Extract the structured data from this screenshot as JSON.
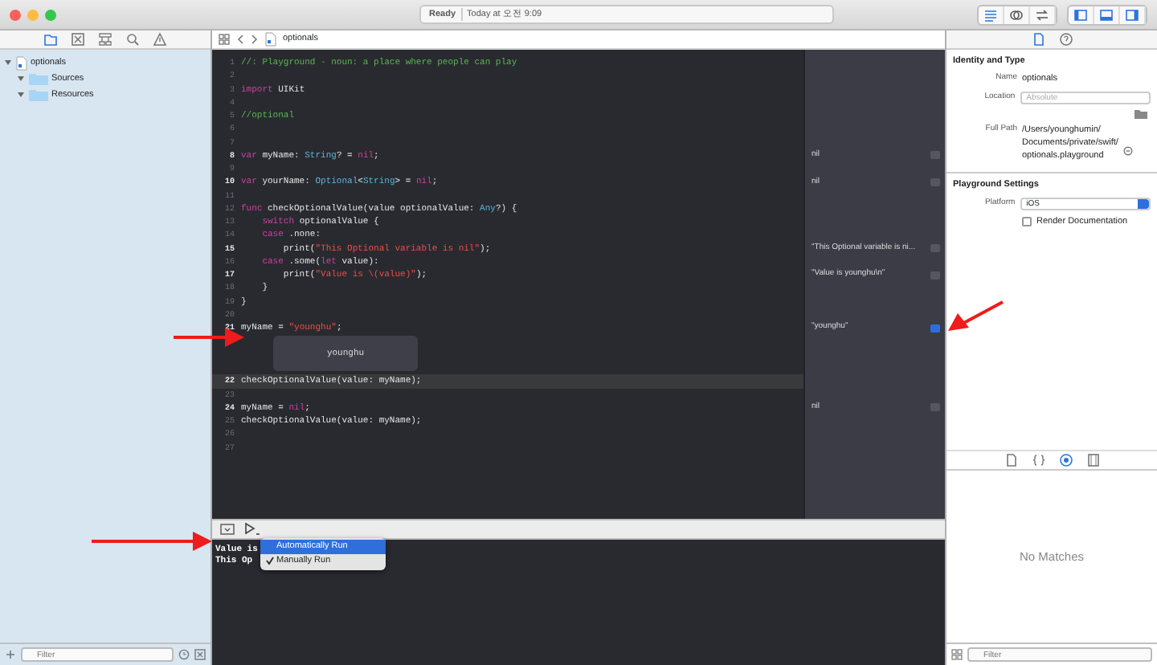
{
  "window": {
    "status": "Ready",
    "time": "Today at 오전 9:09"
  },
  "toolbar_buttons": [
    {
      "kind": "standard",
      "selected": true
    },
    {
      "kind": "assistant",
      "selected": false
    },
    {
      "kind": "version",
      "selected": false
    },
    {
      "kind": "navigator",
      "selected": true
    },
    {
      "kind": "debug",
      "selected": true
    },
    {
      "kind": "utilities",
      "selected": true
    }
  ],
  "navigator": {
    "tabs": [
      {
        "kind": "folder",
        "selected": true
      },
      {
        "kind": "xbox",
        "selected": false
      },
      {
        "kind": "hierarchy",
        "selected": false
      },
      {
        "kind": "search",
        "selected": false
      },
      {
        "kind": "warning",
        "selected": false
      }
    ],
    "tree": [
      {
        "label": "optionals",
        "kind": "file",
        "expanded": true,
        "children": [
          {
            "label": "Sources",
            "kind": "folder",
            "expanded": true
          },
          {
            "label": "Resources",
            "kind": "folder",
            "expanded": true
          }
        ]
      }
    ],
    "filter": {
      "placeholder": "Filter"
    }
  },
  "jump_bar": {
    "file": "optionals"
  },
  "code": [
    {
      "number": "1",
      "marked": false,
      "current": false,
      "tokens": [
        {
          "kind": "comment",
          "text": "//: Playground - noun: a place where people can play"
        }
      ]
    },
    {
      "number": "2",
      "marked": false,
      "current": false
    },
    {
      "number": "3",
      "marked": false,
      "current": false,
      "tokens": [
        {
          "kind": "keyword",
          "text": "import"
        },
        {
          "kind": "plain",
          "text": " UIKit"
        }
      ]
    },
    {
      "number": "4",
      "marked": false,
      "current": false
    },
    {
      "number": "5",
      "marked": false,
      "current": false,
      "tokens": [
        {
          "kind": "comment",
          "text": "//optional"
        }
      ]
    },
    {
      "number": "6",
      "marked": false,
      "current": false
    },
    {
      "number": "7",
      "marked": false,
      "current": false
    },
    {
      "number": "8",
      "marked": true,
      "current": false,
      "tokens": [
        {
          "kind": "keyword",
          "text": "var"
        },
        {
          "kind": "plain",
          "text": " myName: "
        },
        {
          "kind": "type",
          "text": "String"
        },
        {
          "kind": "plain",
          "text": "? = "
        },
        {
          "kind": "keyword",
          "text": "nil"
        },
        {
          "kind": "plain",
          "text": ";"
        }
      ],
      "result": {
        "text": "nil",
        "quicklook_selected": false
      }
    },
    {
      "number": "9",
      "marked": false,
      "current": false
    },
    {
      "number": "10",
      "marked": true,
      "current": false,
      "tokens": [
        {
          "kind": "keyword",
          "text": "var"
        },
        {
          "kind": "plain",
          "text": " yourName: "
        },
        {
          "kind": "type",
          "text": "Optional"
        },
        {
          "kind": "plain",
          "text": "<"
        },
        {
          "kind": "type",
          "text": "String"
        },
        {
          "kind": "plain",
          "text": "> = "
        },
        {
          "kind": "keyword",
          "text": "nil"
        },
        {
          "kind": "plain",
          "text": ";"
        }
      ],
      "result": {
        "text": "nil",
        "quicklook_selected": false
      }
    },
    {
      "number": "11",
      "marked": false,
      "current": false
    },
    {
      "number": "12",
      "marked": false,
      "current": false,
      "tokens": [
        {
          "kind": "keyword",
          "text": "func"
        },
        {
          "kind": "plain",
          "text": " checkOptionalValue(value optionalValue: "
        },
        {
          "kind": "type",
          "text": "Any"
        },
        {
          "kind": "plain",
          "text": "?) {"
        }
      ]
    },
    {
      "number": "13",
      "marked": false,
      "current": false,
      "tokens": [
        {
          "kind": "keyword",
          "text": "    switch"
        },
        {
          "kind": "plain",
          "text": " optionalValue {"
        }
      ]
    },
    {
      "number": "14",
      "marked": false,
      "current": false,
      "tokens": [
        {
          "kind": "keyword",
          "text": "    case"
        },
        {
          "kind": "plain",
          "text": " .none:"
        }
      ]
    },
    {
      "number": "15",
      "marked": true,
      "current": false,
      "tokens": [
        {
          "kind": "plain",
          "text": "        print("
        },
        {
          "kind": "string",
          "text": "\"This Optional variable is nil\""
        },
        {
          "kind": "plain",
          "text": ");"
        }
      ],
      "result": {
        "text": "\"This Optional variable is ni...",
        "quicklook_selected": false
      }
    },
    {
      "number": "16",
      "marked": false,
      "current": false,
      "tokens": [
        {
          "kind": "keyword",
          "text": "    case"
        },
        {
          "kind": "plain",
          "text": " .some("
        },
        {
          "kind": "keyword",
          "text": "let"
        },
        {
          "kind": "plain",
          "text": " value):"
        }
      ]
    },
    {
      "number": "17",
      "marked": true,
      "current": false,
      "tokens": [
        {
          "kind": "plain",
          "text": "        print("
        },
        {
          "kind": "string",
          "text": "\"Value is \\(value)\""
        },
        {
          "kind": "plain",
          "text": ");"
        }
      ],
      "result": {
        "text": "\"Value is younghu\\n\"",
        "quicklook_selected": false
      }
    },
    {
      "number": "18",
      "marked": false,
      "current": false,
      "tokens": [
        {
          "kind": "plain",
          "text": "    }"
        }
      ]
    },
    {
      "number": "19",
      "marked": false,
      "current": false,
      "tokens": [
        {
          "kind": "plain",
          "text": "}"
        }
      ]
    },
    {
      "number": "20",
      "marked": false,
      "current": false
    },
    {
      "number": "21",
      "marked": true,
      "current": false,
      "tokens": [
        {
          "kind": "plain",
          "text": "myName = "
        },
        {
          "kind": "string",
          "text": "\"younghu\""
        },
        {
          "kind": "plain",
          "text": ";"
        }
      ],
      "result": {
        "text": "\"younghu\"",
        "quicklook_selected": true
      },
      "inline_result": "younghu"
    },
    {
      "number": "22",
      "marked": true,
      "current": true,
      "tokens": [
        {
          "kind": "plain",
          "text": "checkOptionalValue(value: myName);"
        }
      ]
    },
    {
      "number": "23",
      "marked": false,
      "current": false
    },
    {
      "number": "24",
      "marked": true,
      "current": false,
      "tokens": [
        {
          "kind": "plain",
          "text": "myName = "
        },
        {
          "kind": "keyword",
          "text": "nil"
        },
        {
          "kind": "plain",
          "text": ";"
        }
      ],
      "result": {
        "text": "nil",
        "quicklook_selected": false
      }
    },
    {
      "number": "25",
      "marked": false,
      "current": false,
      "tokens": [
        {
          "kind": "plain",
          "text": "checkOptionalValue(value: myName);"
        }
      ]
    },
    {
      "number": "26",
      "marked": false,
      "current": false
    },
    {
      "number": "27",
      "marked": false,
      "current": false
    }
  ],
  "console": {
    "lines": [
      "Value is",
      "This Op"
    ]
  },
  "run_menu": [
    {
      "label": "Automatically Run",
      "highlighted": true,
      "checked": false
    },
    {
      "label": "Manually Run",
      "highlighted": false,
      "checked": true
    }
  ],
  "inspector": {
    "tabs": [
      {
        "kind": "file",
        "selected": true
      },
      {
        "kind": "help",
        "selected": false
      }
    ],
    "identity": {
      "title": "Identity and Type",
      "name_label": "Name",
      "name": "optionals",
      "location_label": "Location",
      "location": "Absolute",
      "path_label": "Full Path",
      "path_lines": [
        "/Users/younghumin/",
        "Documents/private/swift/",
        "optionals.playground"
      ]
    },
    "playground": {
      "title": "Playground Settings",
      "platform_label": "Platform",
      "platform": "iOS",
      "render_label": "Render Documentation",
      "render_checked": false
    },
    "library_tabs": [
      {
        "kind": "file",
        "selected": false
      },
      {
        "kind": "braces",
        "selected": false
      },
      {
        "kind": "target",
        "selected": true
      },
      {
        "kind": "square",
        "selected": false
      }
    ],
    "library_empty": "No Matches",
    "filter": {
      "placeholder": "Filter"
    }
  }
}
